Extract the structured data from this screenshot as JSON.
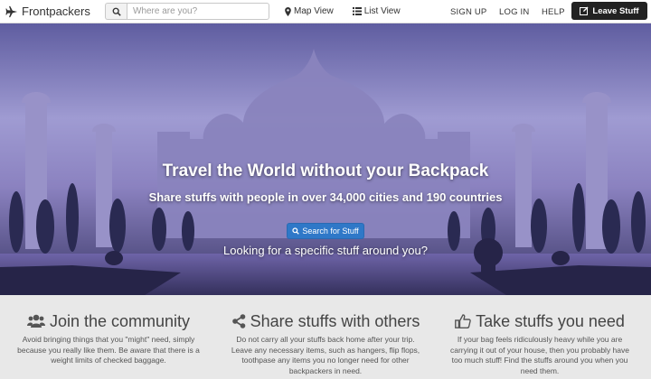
{
  "navbar": {
    "brand": "Frontpackers",
    "brand_icon": "airplane-icon",
    "search_placeholder": "Where are you?",
    "map_view": "Map View",
    "list_view": "List View",
    "signup": "SIGN UP",
    "login": "LOG IN",
    "help": "HELP",
    "leave_stuff": "Leave Stuff"
  },
  "hero": {
    "title": "Travel the World without your Backpack",
    "subtitle": "Share stuffs with people in over 34,000 cities and 190 countries",
    "search_button": "Search for Stuff",
    "question": "Looking for a specific stuff around you?"
  },
  "features": [
    {
      "icon": "users-icon",
      "title": "Join the community",
      "text": "Avoid bringing things that you \"might\" need, simply because you really like them. Be aware that there is a weight limits of checked baggage."
    },
    {
      "icon": "share-icon",
      "title": "Share stuffs with others",
      "text": "Do not carry all your stuffs back home after your trip. Leave any necessary items, such as hangers, flip flops, toothpase any items you no longer need for other backpackers in need."
    },
    {
      "icon": "thumbs-up-icon",
      "title": "Take stuffs you need",
      "text": "If your bag feels ridiculously heavy while you are carrying it out of your house, then you probably have too much stuff! Find the stuffs around you when you need them."
    }
  ],
  "colors": {
    "accent": "#2f78c8",
    "dark_button": "#222222",
    "features_bg": "#e8e8e8"
  }
}
